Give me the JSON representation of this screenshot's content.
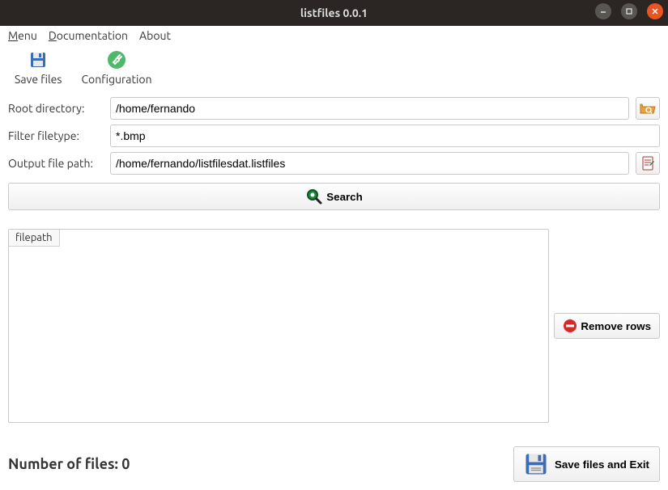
{
  "window": {
    "title": "listfiles 0.0.1"
  },
  "menubar": {
    "menu": "Menu",
    "documentation": "Documentation",
    "about": "About"
  },
  "toolbar": {
    "save_files": "Save files",
    "configuration": "Configuration"
  },
  "form": {
    "root_label": "Root directory:",
    "root_value": "/home/fernando",
    "filter_label": "Filter filetype:",
    "filter_value": "*.bmp",
    "output_label": "Output file path:",
    "output_value": "/home/fernando/listfilesdat.listfiles"
  },
  "buttons": {
    "search": "Search",
    "remove_rows": "Remove rows",
    "save_and_exit": "Save files and Exit"
  },
  "table": {
    "header": "filepath"
  },
  "status": {
    "count_label": "Number of files: ",
    "count_value": "0"
  }
}
